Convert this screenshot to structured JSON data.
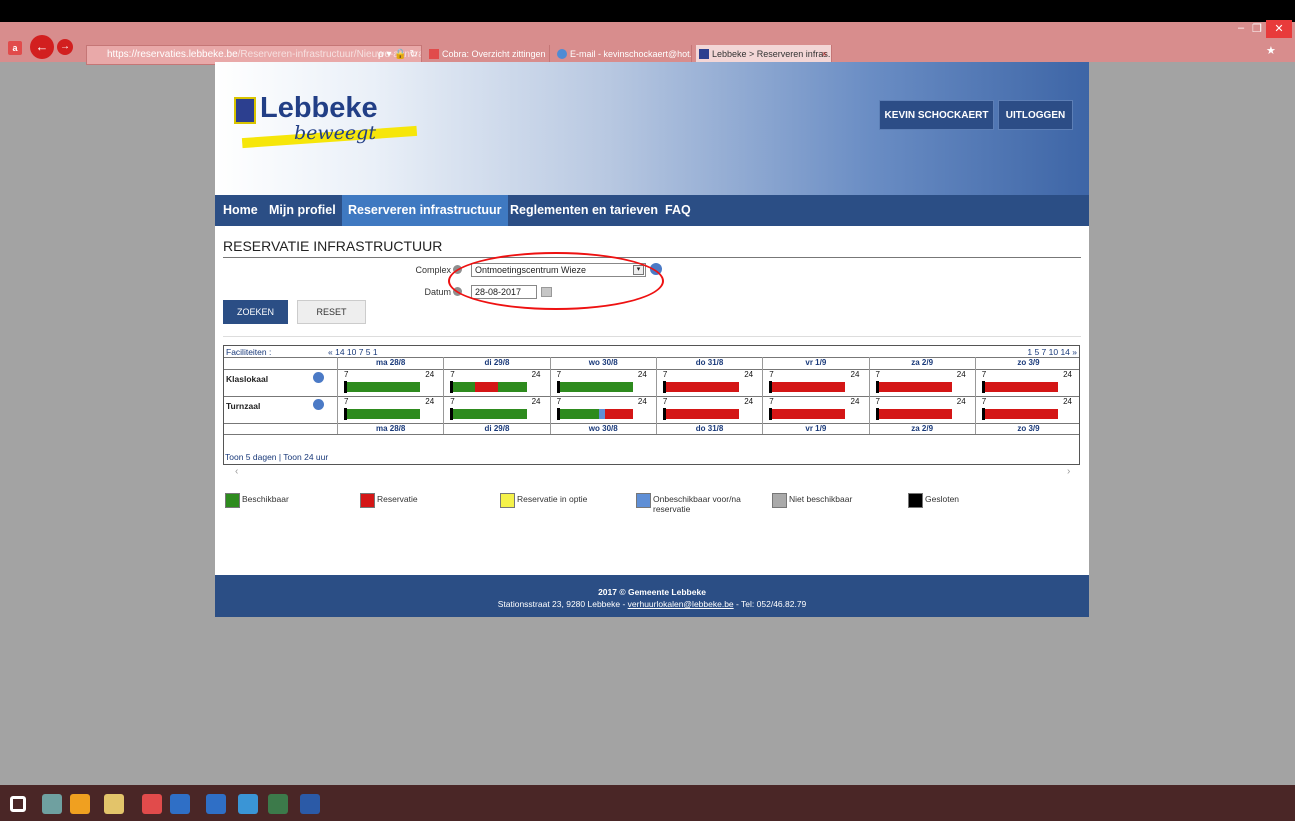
{
  "browser": {
    "address_host": "https://reservaties.",
    "address_domain": "lebbeke.be",
    "address_path": "/Reserveren-infrastructuur/Nieuwe-aanvraag.aspx",
    "address_controls": "ρ ▾ 🔒 ↻",
    "tabs": [
      {
        "label": "Cobra: Overzicht zittingen"
      },
      {
        "label": "E-mail - kevinschockaert@hot..."
      },
      {
        "label": "Lebbeke > Reserveren infras..."
      }
    ],
    "tab_close": "×",
    "window_controls": {
      "minimize": "–",
      "restore": "❐",
      "close": "✕"
    }
  },
  "header": {
    "logo_word": "Lebbeke",
    "logo_script": "beweegt",
    "user_button": "KEVIN SCHOCKAERT",
    "logout_button": "UITLOGGEN"
  },
  "nav": [
    {
      "label": "Home"
    },
    {
      "label": "Mijn profiel"
    },
    {
      "label": "Reserveren infrastructuur"
    },
    {
      "label": "Reglementen en tarieven"
    },
    {
      "label": "FAQ"
    }
  ],
  "page_title": "RESERVATIE INFRASTRUCTUUR",
  "form": {
    "complex_label": "Complex",
    "complex_value": "Ontmoetingscentrum Wieze",
    "complex_arrow": "▾",
    "datum_label": "Datum",
    "datum_value": "28-08-2017",
    "search_button": "ZOEKEN",
    "reset_button": "RESET"
  },
  "grid": {
    "facilities_label": "Faciliteiten :",
    "nav_back": "« 14 10 7 5 1",
    "nav_forward": "1 5 7 10 14 »",
    "days": [
      "ma 28/8",
      "di 29/8",
      "wo 30/8",
      "do 31/8",
      "vr 1/9",
      "za 2/9",
      "zo 3/9"
    ],
    "hour_start": "7",
    "hour_end": "24",
    "rows": [
      {
        "name": "Klaslokaal",
        "days": [
          [
            {
              "c": "g",
              "from": 0,
              "to": 1
            }
          ],
          [
            {
              "c": "g",
              "from": 0,
              "to": 0.32
            },
            {
              "c": "r",
              "from": 0.32,
              "to": 0.62
            },
            {
              "c": "g",
              "from": 0.62,
              "to": 1
            }
          ],
          [
            {
              "c": "g",
              "from": 0,
              "to": 1
            }
          ],
          [
            {
              "c": "r",
              "from": 0,
              "to": 1
            }
          ],
          [
            {
              "c": "r",
              "from": 0,
              "to": 1
            }
          ],
          [
            {
              "c": "r",
              "from": 0,
              "to": 1
            }
          ],
          [
            {
              "c": "r",
              "from": 0,
              "to": 1
            }
          ]
        ]
      },
      {
        "name": "Turnzaal",
        "days": [
          [
            {
              "c": "g",
              "from": 0,
              "to": 1
            }
          ],
          [
            {
              "c": "g",
              "from": 0,
              "to": 1
            }
          ],
          [
            {
              "c": "g",
              "from": 0,
              "to": 0.56
            },
            {
              "c": "b",
              "from": 0.56,
              "to": 0.64
            },
            {
              "c": "r",
              "from": 0.64,
              "to": 1
            }
          ],
          [
            {
              "c": "r",
              "from": 0,
              "to": 1
            }
          ],
          [
            {
              "c": "r",
              "from": 0,
              "to": 1
            }
          ],
          [
            {
              "c": "r",
              "from": 0,
              "to": 1
            }
          ],
          [
            {
              "c": "r",
              "from": 0,
              "to": 1
            }
          ]
        ]
      }
    ],
    "footer_links": "Toon 5 dagen | Toon 24 uur",
    "scroll_left": "‹",
    "scroll_right": "›"
  },
  "legend": [
    {
      "label": "Beschikbaar",
      "color": "#2e8b1e"
    },
    {
      "label": "Reservatie",
      "color": "#d41616"
    },
    {
      "label": "Reservatie in optie",
      "color": "#f5f24a"
    },
    {
      "label": "Onbeschikbaar voor/na reservatie",
      "color": "#5f8fd6"
    },
    {
      "label": "Niet beschikbaar",
      "color": "#aaaaaa"
    },
    {
      "label": "Gesloten",
      "color": "#000000"
    }
  ],
  "colors": {
    "g": "#2e8b1e",
    "r": "#d41616",
    "b": "#5f8fd6"
  },
  "footer": {
    "line1": "2017 © Gemeente Lebbeke",
    "line2_prefix": "Stationsstraat 23, 9280 Lebbeke - ",
    "email": "verhuurlokalen@lebbeke.be",
    "line2_suffix": " - Tel: 052/46.82.79"
  },
  "taskbar_icons": [
    "windows-start-icon",
    "file-explorer-icon",
    "chrome-icon",
    "files-icon",
    "acrobat-icon",
    "outlook-icon",
    "tm-icon",
    "wifi-icon",
    "app-icon",
    "word-icon"
  ]
}
